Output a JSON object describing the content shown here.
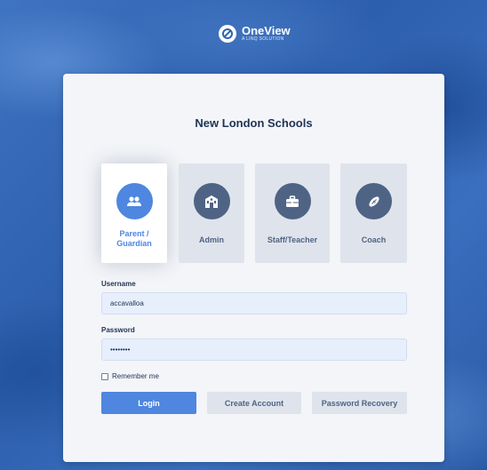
{
  "brand": {
    "name": "OneView",
    "tagline": "A LINQ SOLUTION",
    "logo_icon": "oneview-logo-icon"
  },
  "login": {
    "school_name": "New London Schools",
    "roles": [
      {
        "label": "Parent / Guardian",
        "icon": "parent-guardian-icon",
        "selected": true
      },
      {
        "label": "Admin",
        "icon": "admin-building-icon",
        "selected": false
      },
      {
        "label": "Staff/Teacher",
        "icon": "briefcase-icon",
        "selected": false
      },
      {
        "label": "Coach",
        "icon": "football-icon",
        "selected": false
      }
    ],
    "username": {
      "label": "Username",
      "value": "accavalloa"
    },
    "password": {
      "label": "Password",
      "value": "••••••••"
    },
    "remember_me": {
      "label": "Remember me",
      "checked": false
    },
    "buttons": {
      "login": "Login",
      "create_account": "Create Account",
      "password_recovery": "Password Recovery"
    }
  },
  "colors": {
    "accent": "#4e86e0",
    "background": "#2f63b0",
    "card": "#f3f5f8",
    "tile": "#dfe4ec",
    "icon_circle": "#4f6385",
    "title_text": "#1f3355"
  }
}
